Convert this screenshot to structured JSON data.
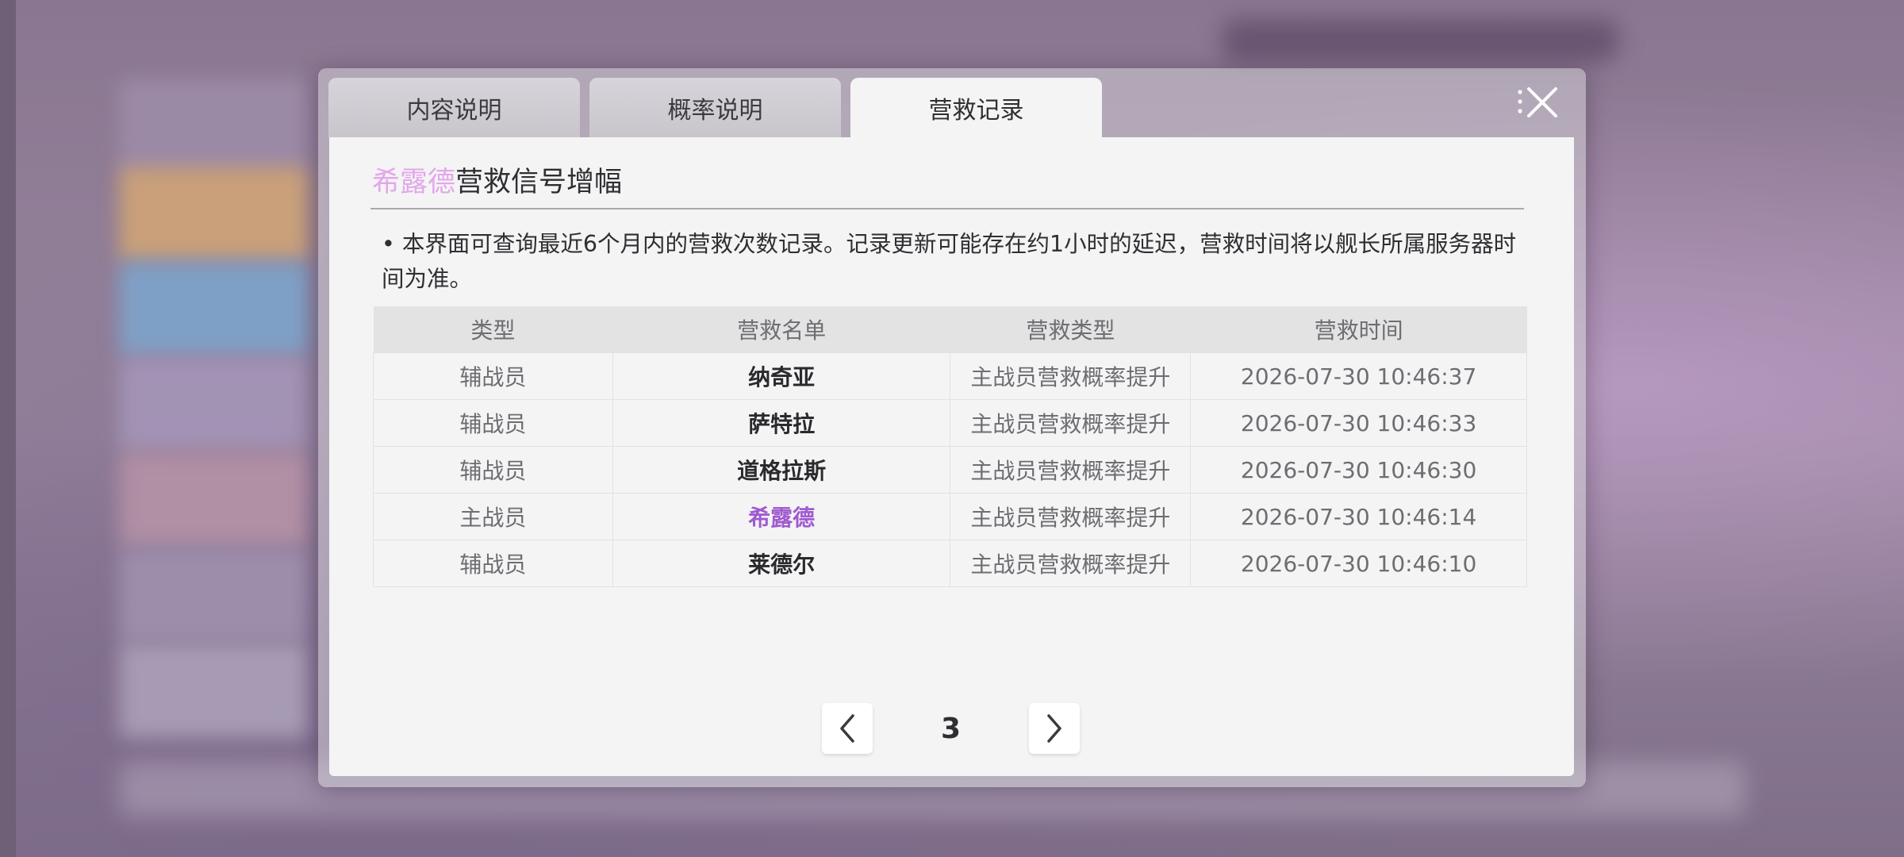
{
  "tabs": [
    {
      "label": "内容说明",
      "active": false
    },
    {
      "label": "概率说明",
      "active": false
    },
    {
      "label": "营救记录",
      "active": true
    }
  ],
  "panel": {
    "title_highlight": "希露德",
    "title_rest": "营救信号增幅",
    "notice": "• 本界面可查询最近6个月内的营救次数记录。记录更新可能存在约1小时的延迟，营救时间将以舰长所属服务器时间为准。"
  },
  "table": {
    "headers": [
      "类型",
      "营救名单",
      "营救类型",
      "营救时间"
    ],
    "rows": [
      {
        "type": "辅战员",
        "name": "纳奇亚",
        "rescue_type": "主战员营救概率提升",
        "time": "2026-07-30 10:46:37"
      },
      {
        "type": "辅战员",
        "name": "萨特拉",
        "rescue_type": "主战员营救概率提升",
        "time": "2026-07-30 10:46:33"
      },
      {
        "type": "辅战员",
        "name": "道格拉斯",
        "rescue_type": "主战员营救概率提升",
        "time": "2026-07-30 10:46:30"
      },
      {
        "type": "主战员",
        "name": "希露德",
        "rescue_type": "主战员营救概率提升",
        "time": "2026-07-30 10:46:14"
      },
      {
        "type": "辅战员",
        "name": "莱德尔",
        "rescue_type": "主战员营救概率提升",
        "time": "2026-07-30 10:46:10"
      }
    ]
  },
  "pager": {
    "page": "3",
    "prev_icon": "chevron-left-icon",
    "next_icon": "chevron-right-icon"
  },
  "icons": {
    "close": "close-icon"
  },
  "colors": {
    "highlight_name": "#e4a6ec",
    "self_name": "#a05ad0",
    "panel_bg": "#f4f4f4"
  }
}
